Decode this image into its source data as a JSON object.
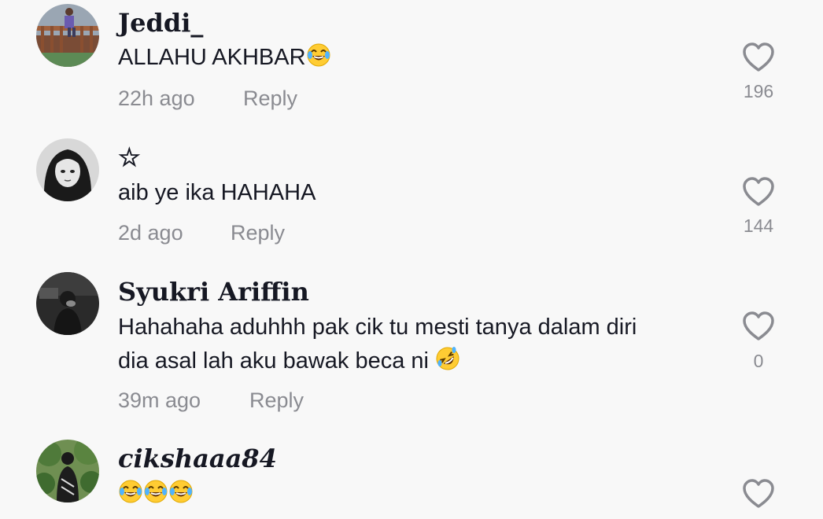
{
  "comments": [
    {
      "username": "Jeddi_",
      "text": "ALLAHU AKHBAR",
      "emojis": [
        "face-with-tears-of-joy"
      ],
      "time": "22h ago",
      "reply_label": "Reply",
      "likes": "196"
    },
    {
      "username": "☆",
      "text": "aib ye ika HAHAHA",
      "emojis": [],
      "time": "2d ago",
      "reply_label": "Reply",
      "likes": "144"
    },
    {
      "username": "Syukri  Ariffin",
      "text_line1": "Hahahaha aduhhh pak cik tu mesti tanya dalam diri",
      "text_line2": "dia asal lah aku bawak beca ni",
      "emojis": [
        "rolling-on-the-floor-laughing"
      ],
      "time": "39m ago",
      "reply_label": "Reply",
      "likes": "0"
    },
    {
      "username": "cikshaaa84",
      "text": "",
      "emojis": [
        "face-with-tears-of-joy",
        "face-with-tears-of-joy",
        "face-with-tears-of-joy"
      ]
    }
  ],
  "icons": {
    "like": "heart-outline-icon"
  },
  "colors": {
    "background": "#f8f8f8",
    "primary_text": "#161823",
    "secondary_text": "#8a8b91",
    "heart_outline": "#8a8b91"
  }
}
